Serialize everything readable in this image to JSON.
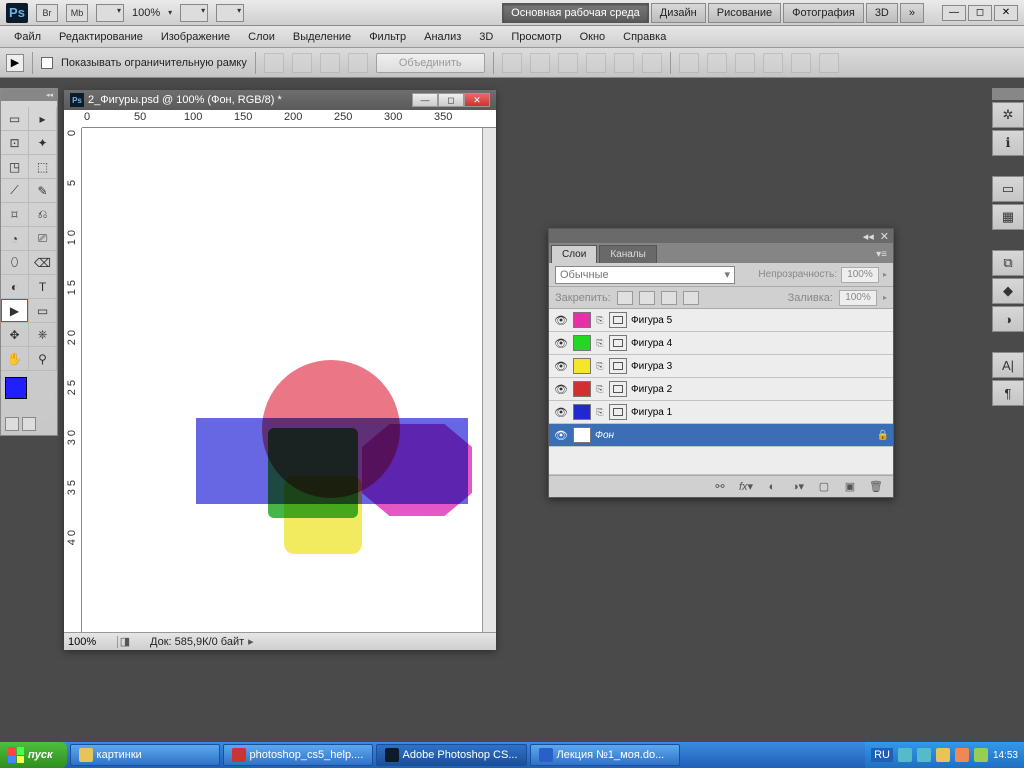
{
  "appbar": {
    "br": "Br",
    "mb": "Mb",
    "zoom": "100%",
    "workspaces": [
      "Основная рабочая среда",
      "Дизайн",
      "Рисование",
      "Фотография",
      "3D"
    ],
    "more": "»"
  },
  "menu": [
    "Файл",
    "Редактирование",
    "Изображение",
    "Слои",
    "Выделение",
    "Фильтр",
    "Анализ",
    "3D",
    "Просмотр",
    "Окно",
    "Справка"
  ],
  "options": {
    "show_bbox_label": "Показывать ограничительную рамку",
    "merge": "Объединить"
  },
  "doc": {
    "title": "2_Фигуры.psd @ 100% (Фон, RGB/8) *",
    "ruler_h": [
      "0",
      "50",
      "100",
      "150",
      "200",
      "250",
      "300",
      "350"
    ],
    "ruler_v": [
      "0",
      "5",
      "1 0",
      "1 5",
      "2 0",
      "2 5",
      "3 0",
      "3 5",
      "4 0"
    ],
    "zoom": "100%",
    "status": "Док: 585,9К/0 байт"
  },
  "layers_panel": {
    "tabs": [
      "Слои",
      "Каналы"
    ],
    "blend": "Обычные",
    "opacity_label": "Непрозрачность:",
    "opacity_value": "100%",
    "lock_label": "Закрепить:",
    "fill_label": "Заливка:",
    "fill_value": "100%",
    "layers": [
      {
        "name": "Фигура 5",
        "color": "#e62fa8"
      },
      {
        "name": "Фигура 4",
        "color": "#22d822"
      },
      {
        "name": "Фигура 3",
        "color": "#f5e62a"
      },
      {
        "name": "Фигура 2",
        "color": "#d22f2f"
      },
      {
        "name": "Фигура 1",
        "color": "#2228d0"
      }
    ],
    "bg_layer": "Фон"
  },
  "taskbar": {
    "start": "пуск",
    "items": [
      "картинки",
      "photoshop_cs5_help....",
      "Adobe Photoshop CS...",
      "Лекция №1_моя.do..."
    ],
    "lang": "RU",
    "clock": "14:53"
  },
  "colors": {
    "fg": "#2020ff",
    "bg": "#ffffff"
  },
  "icons": {
    "tools": [
      "▭",
      "▸",
      "⊡",
      "✦",
      "◳",
      "⬚",
      "⟋",
      "✎",
      "⌑",
      "⎌",
      "◔",
      "⎚",
      "⬯",
      "⌫",
      "⟆",
      "⬳",
      "◐",
      "⚲",
      "✒",
      "T",
      "▶",
      "▭",
      "✥",
      "⎈",
      "✋",
      "⚲"
    ]
  }
}
